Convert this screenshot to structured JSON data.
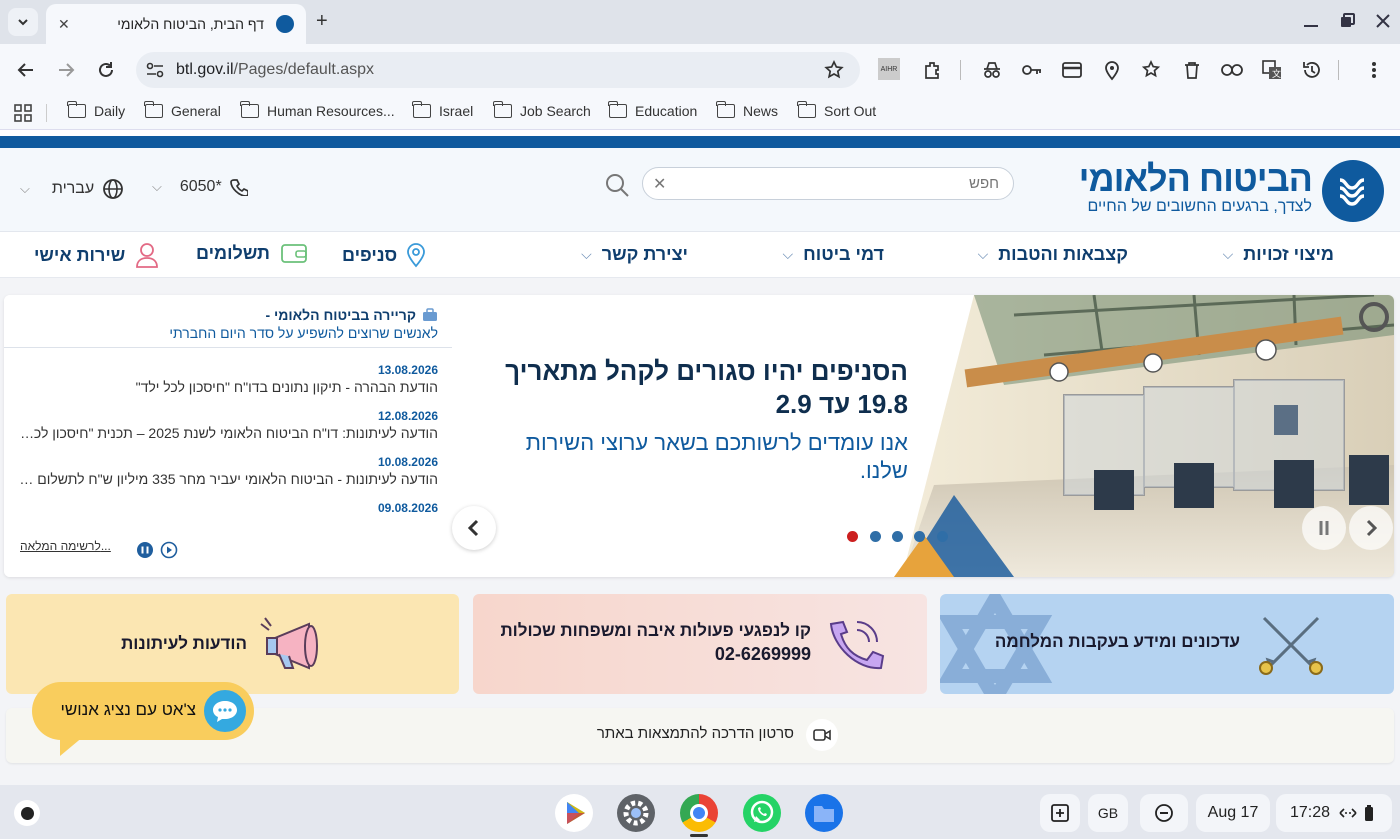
{
  "browser": {
    "tab_title": "דף הבית, הביטוח הלאומי",
    "tab_close": "✕",
    "new_tab": "+",
    "url_domain": "btl.gov.il",
    "url_path": "/Pages/default.aspx",
    "bookmarks": [
      "Daily",
      "General",
      "Human Resources...",
      "Israel",
      "Job Search",
      "Education",
      "News",
      "Sort Out"
    ]
  },
  "site": {
    "logo_main": "הביטוח הלאומי",
    "logo_sub": "לצדך, ברגעים החשובים של החיים",
    "search_placeholder": "חפש",
    "phone": "6050*",
    "language": "עברית",
    "nav": [
      "מיצוי זכויות",
      "קצבאות והטבות",
      "דמי ביטוח",
      "יצירת קשר"
    ],
    "nav_icons": [
      "סניפים",
      "תשלומים",
      "שירות אישי"
    ]
  },
  "news": {
    "title": "קריירה בביטוח הלאומי -",
    "subtitle": "לאנשים שרוצים להשפיע על סדר היום החברתי",
    "items": [
      {
        "date": "13.08.2026",
        "text": "הודעת הבהרה - תיקון נתונים בדו\"ח \"חיסכון לכל ילד\""
      },
      {
        "date": "12.08.2026",
        "text": "הודעה לעיתונות: דו\"ח הביטוח הלאומי לשנת 2025 – תכנית \"חיסכון לכל ילד\""
      },
      {
        "date": "10.08.2026",
        "text": "הודעה לעיתונות - הביטוח הלאומי יעביר מחר 335 מיליון ש\"ח לתשלום מענקים"
      },
      {
        "date": "09.08.2026",
        "text": ""
      }
    ],
    "more": "לרשימה המלאה..."
  },
  "hero": {
    "headline": "הסניפים יהיו סגורים לקהל מתאריך 19.8 עד 2.9",
    "sub": "אנו עומדים לרשותכם בשאר ערוצי השירות שלנו.",
    "active_dot": 0,
    "dot_count": 5
  },
  "cards": {
    "war": "עדכונים ומידע בעקבות המלחמה",
    "hotline_text": "קו לנפגעי פעולות איבה ומשפחות שכולות",
    "hotline_phone": "02-6269999",
    "press": "הודעות לעיתונות"
  },
  "tutorial": "סרטון הדרכה להתמצאות באתר",
  "chat": "צ'אט עם נציג אנושי",
  "shelf": {
    "ime": "GB",
    "date": "Aug 17",
    "time": "17:28"
  },
  "colors": {
    "brand": "#0f5a9e",
    "dot_active": "#cc1f1f",
    "dot": "#2f6ea7"
  }
}
